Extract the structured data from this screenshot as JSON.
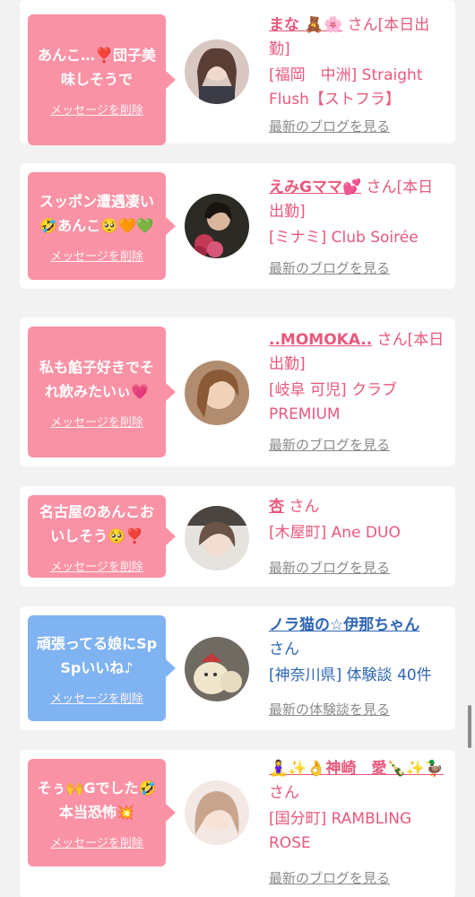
{
  "cards": [
    {
      "message": "あんこ…❣️団子美味しそうで",
      "delete_label": "メッセージを削除",
      "name": "まな 🧸🌸",
      "honorific": " さん[本日出勤]",
      "shop": "[福岡　中洲] Straight Flush【ストフラ】",
      "blog_label": "最新のブログを見る",
      "bubble_color": "#fa92a5"
    },
    {
      "message": "スッポン遭遇凄い🤣あんこ🥺🧡💚",
      "delete_label": "メッセージを削除",
      "name": "えみGママ💕",
      "honorific": " さん[本日出勤]",
      "shop": "[ミナミ] Club Soirée",
      "blog_label": "最新のブログを見る",
      "bubble_color": "#fa92a5"
    },
    {
      "message": "私も餡子好きでそれ飲みたいぃ💗",
      "delete_label": "メッセージを削除",
      "name": "..MOMOKA..",
      "honorific": " さん[本日出勤]",
      "shop": "[岐阜 可児] クラブ PREMIUM",
      "blog_label": "最新のブログを見る",
      "bubble_color": "#fa92a5"
    },
    {
      "message": "名古屋のあんこおいしそう🥺❣️",
      "delete_label": "メッセージを削除",
      "name": "杏",
      "honorific": " さん",
      "shop": "[木屋町] Ane DUO",
      "blog_label": "最新のブログを見る",
      "bubble_color": "#fa92a5"
    },
    {
      "message": "頑張ってる娘にSpSpいいね♪",
      "delete_label": "メッセージを削除",
      "name": "ノラ猫の☆伊那ちゃん",
      "honorific": "さん",
      "shop": "[神奈川県] 体験談 40件",
      "blog_label": "最新の体験談を見る",
      "bubble_color": "#7fb3f2"
    },
    {
      "message": "そぅ🙌Gでした🤣本当恐怖💥",
      "delete_label": "メッセージを削除",
      "name": "🧘‍♀️✨👌神崎　愛🍾✨🦆",
      "honorific": " さん",
      "shop": "[国分町] RAMBLING ROSE",
      "blog_label": "最新のブログを見る",
      "bubble_color": "#fa92a5"
    }
  ],
  "colors": {
    "pink_accent": "#e9587c",
    "blue_accent": "#2f66b3",
    "pink_bubble": "#fa92a5",
    "blue_bubble": "#7fb3f2"
  }
}
